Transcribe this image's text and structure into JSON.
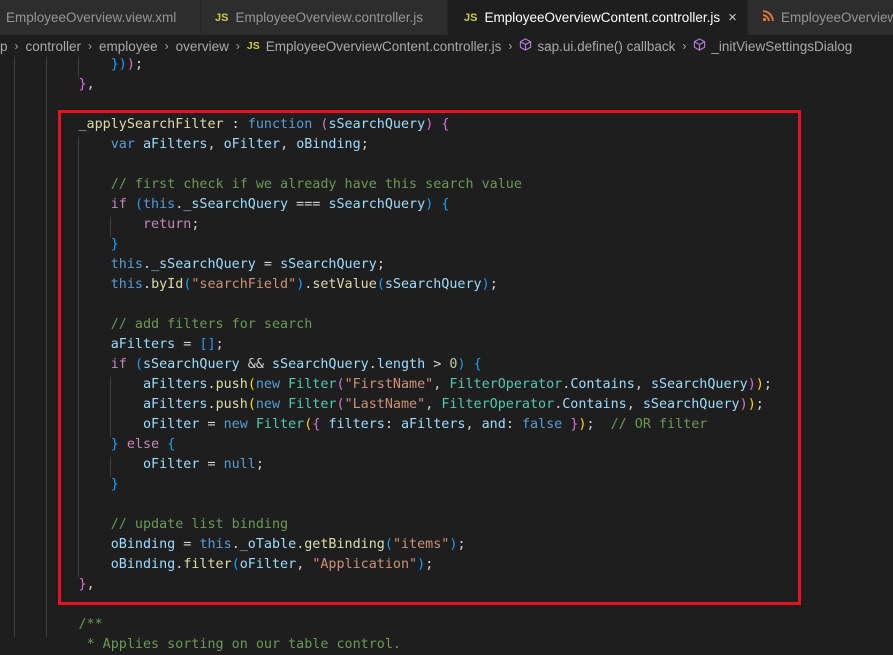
{
  "tabs": [
    {
      "label": "EmployeeOverview.view.xml",
      "icon": "xml-file-icon",
      "active": false
    },
    {
      "label": "EmployeeOverview.controller.js",
      "icon": "js-file-icon",
      "icon_text": "JS",
      "active": false
    },
    {
      "label": "EmployeeOverviewContent.controller.js",
      "icon": "js-file-icon",
      "icon_text": "JS",
      "active": true,
      "close_glyph": "×"
    },
    {
      "label": "EmployeeOverview",
      "icon": "rss-xml-icon",
      "active": false
    }
  ],
  "breadcrumb": {
    "items": [
      "p",
      "controller",
      "employee",
      "overview",
      "EmployeeOverviewContent.controller.js",
      "sap.ui.define() callback",
      "_initViewSettingsDialog"
    ],
    "js_icon_text": "JS",
    "separator_glyph": "›"
  },
  "colors": {
    "highlight_border": "#e81123",
    "editor_bg": "#1e1e1e",
    "comment": "#6a9955",
    "keyword": "#569cd6",
    "string": "#ce9178"
  },
  "code": {
    "lines": [
      [
        [
          "            ",
          "pun"
        ],
        [
          "})",
          "p3"
        ],
        [
          ")",
          "p2"
        ],
        [
          ";",
          "pun"
        ]
      ],
      [
        [
          "        ",
          "pun"
        ],
        [
          "}",
          "p2"
        ],
        [
          ",",
          "pun"
        ]
      ],
      [
        [
          "",
          "pun"
        ]
      ],
      [
        [
          "        ",
          "pun"
        ],
        [
          "_applySearchFilter",
          "fn"
        ],
        [
          " : ",
          "pun"
        ],
        [
          "function",
          "kw"
        ],
        [
          " ",
          "pun"
        ],
        [
          "(",
          "p2"
        ],
        [
          "sSearchQuery",
          "var"
        ],
        [
          ")",
          "p2"
        ],
        [
          " ",
          "pun"
        ],
        [
          "{",
          "p2"
        ]
      ],
      [
        [
          "            ",
          "pun"
        ],
        [
          "var",
          "kw"
        ],
        [
          " ",
          "pun"
        ],
        [
          "aFilters",
          "var"
        ],
        [
          ", ",
          "pun"
        ],
        [
          "oFilter",
          "var"
        ],
        [
          ", ",
          "pun"
        ],
        [
          "oBinding",
          "var"
        ],
        [
          ";",
          "pun"
        ]
      ],
      [
        [
          "",
          "pun"
        ]
      ],
      [
        [
          "            ",
          "pun"
        ],
        [
          "// first check if we already have this search value",
          "com"
        ]
      ],
      [
        [
          "            ",
          "pun"
        ],
        [
          "if",
          "ctl"
        ],
        [
          " ",
          "pun"
        ],
        [
          "(",
          "p3"
        ],
        [
          "this",
          "kw"
        ],
        [
          ".",
          "pun"
        ],
        [
          "_sSearchQuery",
          "var"
        ],
        [
          " === ",
          "pun"
        ],
        [
          "sSearchQuery",
          "var"
        ],
        [
          ")",
          "p3"
        ],
        [
          " ",
          "pun"
        ],
        [
          "{",
          "p3"
        ]
      ],
      [
        [
          "                ",
          "pun"
        ],
        [
          "return",
          "ctl"
        ],
        [
          ";",
          "pun"
        ]
      ],
      [
        [
          "            ",
          "pun"
        ],
        [
          "}",
          "p3"
        ]
      ],
      [
        [
          "            ",
          "pun"
        ],
        [
          "this",
          "kw"
        ],
        [
          ".",
          "pun"
        ],
        [
          "_sSearchQuery",
          "var"
        ],
        [
          " = ",
          "pun"
        ],
        [
          "sSearchQuery",
          "var"
        ],
        [
          ";",
          "pun"
        ]
      ],
      [
        [
          "            ",
          "pun"
        ],
        [
          "this",
          "kw"
        ],
        [
          ".",
          "pun"
        ],
        [
          "byId",
          "fn"
        ],
        [
          "(",
          "p3"
        ],
        [
          "\"searchField\"",
          "str"
        ],
        [
          ")",
          "p3"
        ],
        [
          ".",
          "pun"
        ],
        [
          "setValue",
          "fn"
        ],
        [
          "(",
          "p3"
        ],
        [
          "sSearchQuery",
          "var"
        ],
        [
          ")",
          "p3"
        ],
        [
          ";",
          "pun"
        ]
      ],
      [
        [
          "",
          "pun"
        ]
      ],
      [
        [
          "            ",
          "pun"
        ],
        [
          "// add filters for search",
          "com"
        ]
      ],
      [
        [
          "            ",
          "pun"
        ],
        [
          "aFilters",
          "var"
        ],
        [
          " = ",
          "pun"
        ],
        [
          "[]",
          "p3"
        ],
        [
          ";",
          "pun"
        ]
      ],
      [
        [
          "            ",
          "pun"
        ],
        [
          "if",
          "ctl"
        ],
        [
          " ",
          "pun"
        ],
        [
          "(",
          "p3"
        ],
        [
          "sSearchQuery",
          "var"
        ],
        [
          " && ",
          "pun"
        ],
        [
          "sSearchQuery",
          "var"
        ],
        [
          ".",
          "pun"
        ],
        [
          "length",
          "var"
        ],
        [
          " > ",
          "pun"
        ],
        [
          "0",
          "num"
        ],
        [
          ")",
          "p3"
        ],
        [
          " ",
          "pun"
        ],
        [
          "{",
          "p3"
        ]
      ],
      [
        [
          "                ",
          "pun"
        ],
        [
          "aFilters",
          "var"
        ],
        [
          ".",
          "pun"
        ],
        [
          "push",
          "fn"
        ],
        [
          "(",
          "p1"
        ],
        [
          "new",
          "kw"
        ],
        [
          " ",
          "pun"
        ],
        [
          "Filter",
          "cls"
        ],
        [
          "(",
          "p2"
        ],
        [
          "\"FirstName\"",
          "str"
        ],
        [
          ", ",
          "pun"
        ],
        [
          "FilterOperator",
          "cls"
        ],
        [
          ".",
          "pun"
        ],
        [
          "Contains",
          "var"
        ],
        [
          ", ",
          "pun"
        ],
        [
          "sSearchQuery",
          "var"
        ],
        [
          ")",
          "p2"
        ],
        [
          ")",
          "p1"
        ],
        [
          ";",
          "pun"
        ]
      ],
      [
        [
          "                ",
          "pun"
        ],
        [
          "aFilters",
          "var"
        ],
        [
          ".",
          "pun"
        ],
        [
          "push",
          "fn"
        ],
        [
          "(",
          "p1"
        ],
        [
          "new",
          "kw"
        ],
        [
          " ",
          "pun"
        ],
        [
          "Filter",
          "cls"
        ],
        [
          "(",
          "p2"
        ],
        [
          "\"LastName\"",
          "str"
        ],
        [
          ", ",
          "pun"
        ],
        [
          "FilterOperator",
          "cls"
        ],
        [
          ".",
          "pun"
        ],
        [
          "Contains",
          "var"
        ],
        [
          ", ",
          "pun"
        ],
        [
          "sSearchQuery",
          "var"
        ],
        [
          ")",
          "p2"
        ],
        [
          ")",
          "p1"
        ],
        [
          ";",
          "pun"
        ]
      ],
      [
        [
          "                ",
          "pun"
        ],
        [
          "oFilter",
          "var"
        ],
        [
          " = ",
          "pun"
        ],
        [
          "new",
          "kw"
        ],
        [
          " ",
          "pun"
        ],
        [
          "Filter",
          "cls"
        ],
        [
          "(",
          "p1"
        ],
        [
          "{",
          "p2"
        ],
        [
          " ",
          "pun"
        ],
        [
          "filters",
          "var"
        ],
        [
          ": ",
          "pun"
        ],
        [
          "aFilters",
          "var"
        ],
        [
          ", ",
          "pun"
        ],
        [
          "and",
          "var"
        ],
        [
          ": ",
          "pun"
        ],
        [
          "false",
          "kw"
        ],
        [
          " ",
          "pun"
        ],
        [
          "}",
          "p2"
        ],
        [
          ")",
          "p1"
        ],
        [
          ";",
          "pun"
        ],
        [
          "  ",
          "pun"
        ],
        [
          "// OR filter",
          "com"
        ]
      ],
      [
        [
          "            ",
          "pun"
        ],
        [
          "}",
          "p3"
        ],
        [
          " ",
          "pun"
        ],
        [
          "else",
          "ctl"
        ],
        [
          " ",
          "pun"
        ],
        [
          "{",
          "p3"
        ]
      ],
      [
        [
          "                ",
          "pun"
        ],
        [
          "oFilter",
          "var"
        ],
        [
          " = ",
          "pun"
        ],
        [
          "null",
          "kw"
        ],
        [
          ";",
          "pun"
        ]
      ],
      [
        [
          "            ",
          "pun"
        ],
        [
          "}",
          "p3"
        ]
      ],
      [
        [
          "",
          "pun"
        ]
      ],
      [
        [
          "            ",
          "pun"
        ],
        [
          "// update list binding",
          "com"
        ]
      ],
      [
        [
          "            ",
          "pun"
        ],
        [
          "oBinding",
          "var"
        ],
        [
          " = ",
          "pun"
        ],
        [
          "this",
          "kw"
        ],
        [
          ".",
          "pun"
        ],
        [
          "_oTable",
          "var"
        ],
        [
          ".",
          "pun"
        ],
        [
          "getBinding",
          "fn"
        ],
        [
          "(",
          "p3"
        ],
        [
          "\"items\"",
          "str"
        ],
        [
          ")",
          "p3"
        ],
        [
          ";",
          "pun"
        ]
      ],
      [
        [
          "            ",
          "pun"
        ],
        [
          "oBinding",
          "var"
        ],
        [
          ".",
          "pun"
        ],
        [
          "filter",
          "fn"
        ],
        [
          "(",
          "p3"
        ],
        [
          "oFilter",
          "var"
        ],
        [
          ", ",
          "pun"
        ],
        [
          "\"Application\"",
          "str"
        ],
        [
          ")",
          "p3"
        ],
        [
          ";",
          "pun"
        ]
      ],
      [
        [
          "        ",
          "pun"
        ],
        [
          "}",
          "p2"
        ],
        [
          ",",
          "pun"
        ]
      ],
      [
        [
          "",
          "pun"
        ]
      ],
      [
        [
          "        ",
          "pun"
        ],
        [
          "/**",
          "com"
        ]
      ],
      [
        [
          "         ",
          "pun"
        ],
        [
          "* Applies sorting on our table control.",
          "com"
        ]
      ]
    ]
  }
}
